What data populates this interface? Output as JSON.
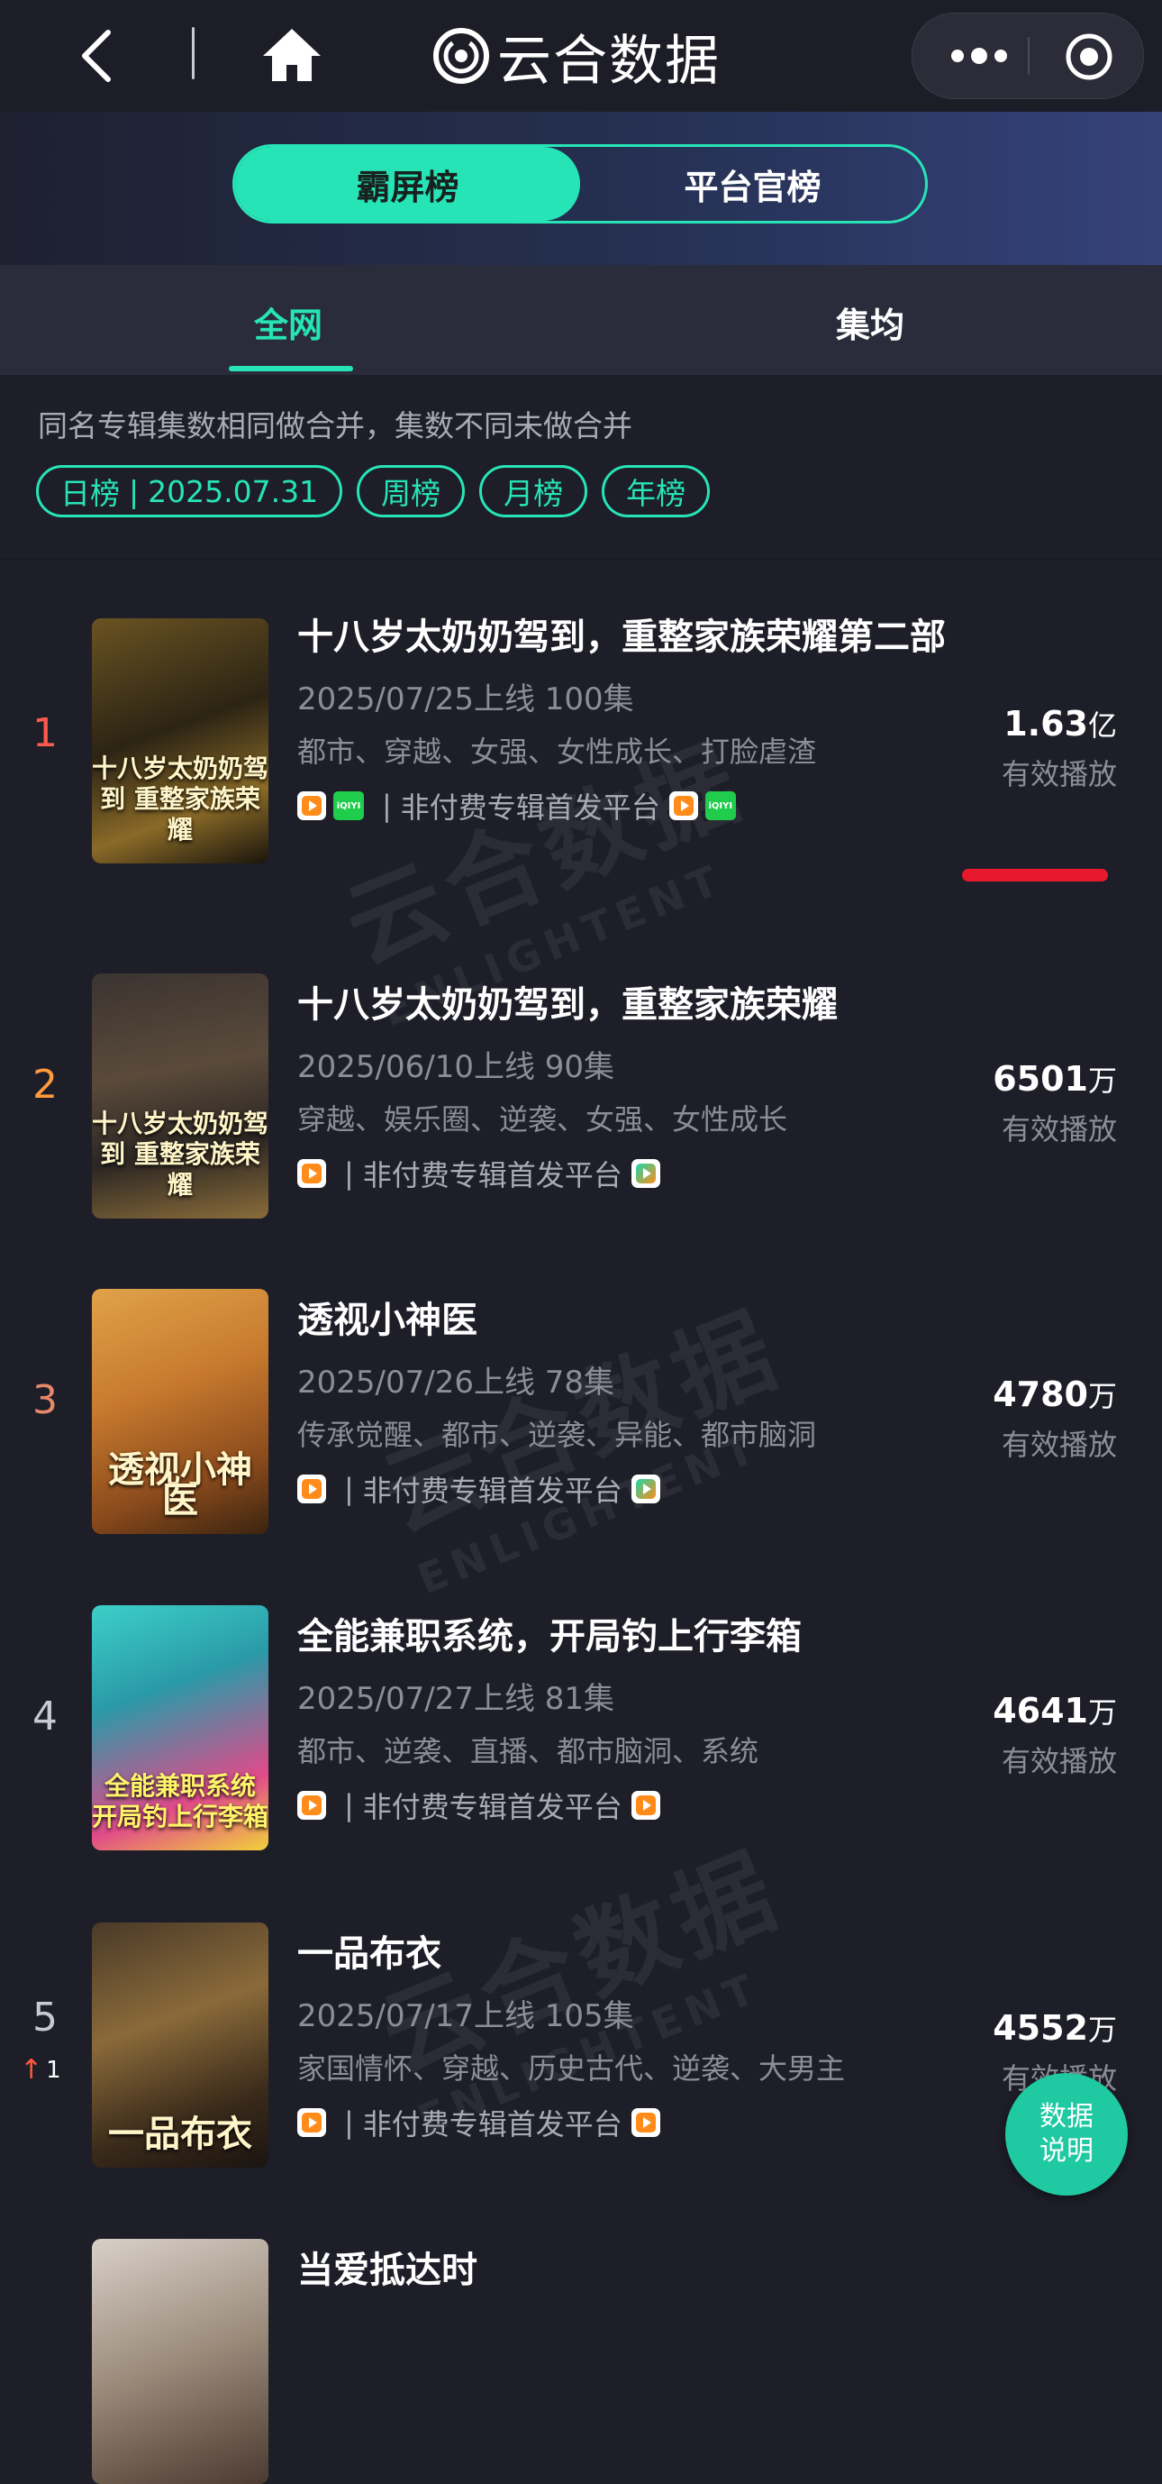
{
  "header": {
    "brand_name": "云合数据",
    "icons": [
      "back-icon",
      "home-icon",
      "more-dots-icon",
      "miniapp-close-icon"
    ]
  },
  "ranking_switch": {
    "active": "霸屏榜",
    "inactive": "平台官榜"
  },
  "sub_tabs": {
    "active": "全网",
    "other": "集均"
  },
  "notice": "同名专辑集数相同做合并，集数不同未做合并",
  "filters": {
    "daily_label": "日榜",
    "daily_date": "2025.07.31",
    "weekly": "周榜",
    "monthly": "月榜",
    "yearly": "年榜"
  },
  "colors": {
    "accent": "#27e4b7",
    "background": "#1d1e28",
    "rank_1": "#ff5a4e",
    "rank_2": "#ff9a3c",
    "rank_3": "#e8886a",
    "rank_other": "#c9cad0",
    "highlight_mark": "#e8192c"
  },
  "items": [
    {
      "rank": "1",
      "title": "十八岁太奶奶驾到，重整家族荣耀第二部",
      "release": "2025/07/25上线 100集",
      "tags": "都市、穿越、女强、女性成长、打脸虐渣",
      "platform_text": "非付费专辑首发平台",
      "play_number": "1.63",
      "play_unit": "亿",
      "play_label": "有效播放",
      "poster_title": "十八岁太奶奶驾到 重整家族荣耀"
    },
    {
      "rank": "2",
      "title": "十八岁太奶奶驾到，重整家族荣耀",
      "release": "2025/06/10上线 90集",
      "tags": "穿越、娱乐圈、逆袭、女强、女性成长",
      "platform_text": "非付费专辑首发平台",
      "play_number": "6501",
      "play_unit": "万",
      "play_label": "有效播放",
      "poster_title": "十八岁太奶奶驾到 重整家族荣耀"
    },
    {
      "rank": "3",
      "title": "透视小神医",
      "release": "2025/07/26上线 78集",
      "tags": "传承觉醒、都市、逆袭、异能、都市脑洞",
      "platform_text": "非付费专辑首发平台",
      "play_number": "4780",
      "play_unit": "万",
      "play_label": "有效播放",
      "poster_title": "透视小神医"
    },
    {
      "rank": "4",
      "title": "全能兼职系统，开局钓上行李箱",
      "release": "2025/07/27上线 81集",
      "tags": "都市、逆袭、直播、都市脑洞、系统",
      "platform_text": "非付费专辑首发平台",
      "play_number": "4641",
      "play_unit": "万",
      "play_label": "有效播放",
      "poster_title": "全能兼职系统 开局钓上行李箱"
    },
    {
      "rank": "5",
      "rank_change": "1",
      "title": "一品布衣",
      "release": "2025/07/17上线 105集",
      "tags": "家国情怀、穿越、历史古代、逆袭、大男主",
      "platform_text": "非付费专辑首发平台",
      "play_number": "4552",
      "play_unit": "万",
      "play_label": "有效播放",
      "poster_title": "一品布衣"
    },
    {
      "title": "当爱抵达时"
    }
  ],
  "watermark": {
    "cn": "云合数据",
    "en": "ENLIGHTENT"
  },
  "float_button": {
    "line1": "数据",
    "line2": "说明"
  }
}
